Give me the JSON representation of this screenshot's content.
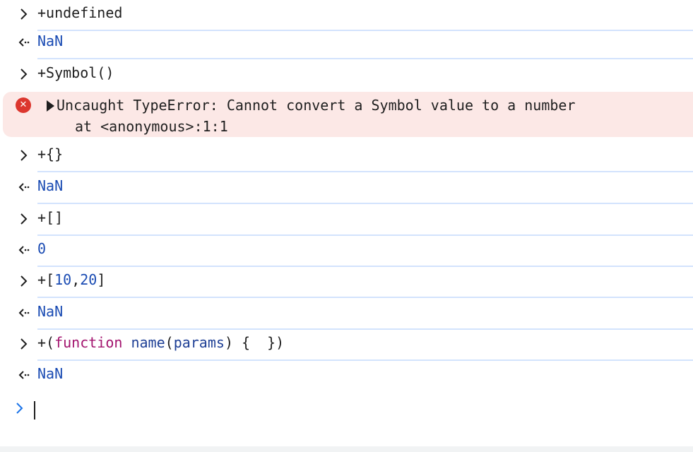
{
  "entries": [
    {
      "type": "input",
      "text": "+undefined"
    },
    {
      "type": "output",
      "text": "NaN"
    },
    {
      "type": "input",
      "text": "+Symbol()"
    },
    {
      "type": "input",
      "text": "+{}"
    },
    {
      "type": "output",
      "text": "NaN"
    },
    {
      "type": "input",
      "text": "+[]"
    },
    {
      "type": "output",
      "text": "0"
    },
    {
      "type": "input",
      "parts": [
        "+[",
        "10",
        ",",
        "20",
        "]"
      ]
    },
    {
      "type": "output",
      "text": "NaN"
    },
    {
      "type": "input",
      "parts": [
        "+(",
        "function",
        " ",
        "name",
        "(",
        "params",
        ") {  })"
      ]
    },
    {
      "type": "output",
      "text": "NaN"
    }
  ],
  "error": {
    "icon": "error-x-icon",
    "message": "Uncaught TypeError: Cannot convert a Symbol value to a number",
    "stack": "at <anonymous>:1:1"
  },
  "prompt": {
    "icon": "prompt-chevron-icon",
    "value": ""
  },
  "colors": {
    "separator": "#d3e3fd",
    "error_bg": "#fce8e6",
    "error_icon": "#dc362e",
    "number": "#1a4bb3",
    "keyword": "#a3146e",
    "prompt_accent": "#1a73e8"
  }
}
